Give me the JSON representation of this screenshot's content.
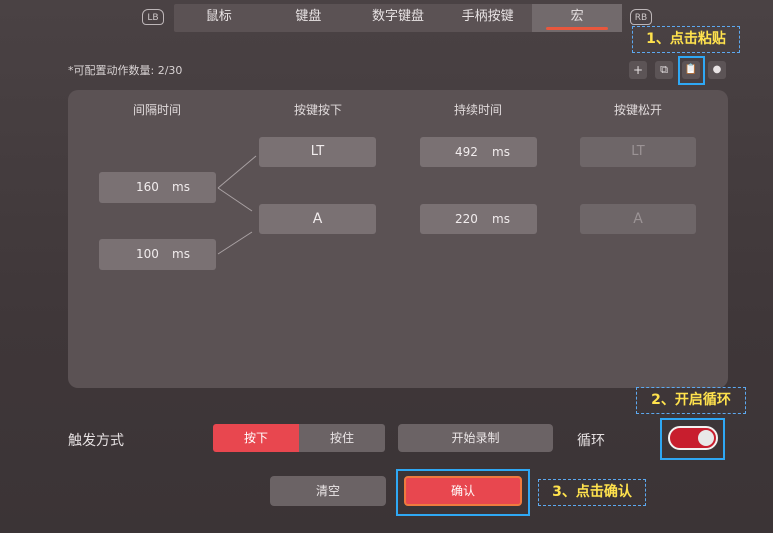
{
  "bumpers": {
    "left": "LB",
    "right": "RB"
  },
  "tabs": [
    {
      "label": "鼠标",
      "active": false
    },
    {
      "label": "键盘",
      "active": false
    },
    {
      "label": "数字键盘",
      "active": false
    },
    {
      "label": "手柄按键",
      "active": false
    },
    {
      "label": "宏",
      "active": true
    }
  ],
  "macro": {
    "count_label": "*可配置动作数量: 2/30",
    "toolbar": {
      "add": "+",
      "copy": "⧉",
      "paste": "📋",
      "record": "●"
    },
    "columns": [
      "间隔时间",
      "按键按下",
      "持续时间",
      "按键松开"
    ],
    "intervals": [
      {
        "value": "160",
        "unit": "ms"
      },
      {
        "value": "100",
        "unit": "ms"
      }
    ],
    "actions": [
      {
        "key_down": "LT",
        "duration": "492",
        "unit": "ms",
        "key_up": "LT"
      },
      {
        "key_down": "A",
        "duration": "220",
        "unit": "ms",
        "key_up": "A"
      }
    ]
  },
  "trigger": {
    "label": "触发方式",
    "press": "按下",
    "hold": "按住",
    "record_button": "开始录制",
    "loop_label": "循环",
    "loop_on": true
  },
  "footer": {
    "clear": "清空",
    "confirm": "确认"
  },
  "callouts": {
    "step1": "1、点击粘贴",
    "step2": "2、开启循环",
    "step3": "3、点击确认"
  },
  "colors": {
    "accent": "#e8474f",
    "callout_text": "#ffe24d",
    "callout_border": "#2fa8f4"
  }
}
